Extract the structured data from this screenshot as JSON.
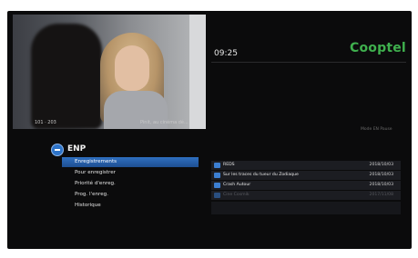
{
  "header": {
    "clock": "09:25",
    "brand": "Cooptel",
    "hint": "Mode EN Pause"
  },
  "preview": {
    "caption_left": "101 · 203",
    "caption_right": "Pinit, au cinéma dé..."
  },
  "section": {
    "title": "ENP"
  },
  "menu": {
    "items": [
      {
        "label": "Enregistrements",
        "active": true
      },
      {
        "label": "Pour enregistrer",
        "active": false
      },
      {
        "label": "Priorité d'enreg.",
        "active": false
      },
      {
        "label": "Prog. l'enreg.",
        "active": false
      },
      {
        "label": "Historique",
        "active": false
      }
    ]
  },
  "recordings": [
    {
      "title": "REDS",
      "date": "2018/10/03"
    },
    {
      "title": "Sur les traces du tueur du Zodiaque",
      "date": "2018/10/03"
    },
    {
      "title": "Crash Autour",
      "date": "2018/10/03"
    },
    {
      "title": "Cine Cosmik",
      "date": "2017/11/08"
    }
  ],
  "colors": {
    "accent": "#2f6fc0",
    "brand": "#3fb04e",
    "background": "#0b0b0c"
  }
}
